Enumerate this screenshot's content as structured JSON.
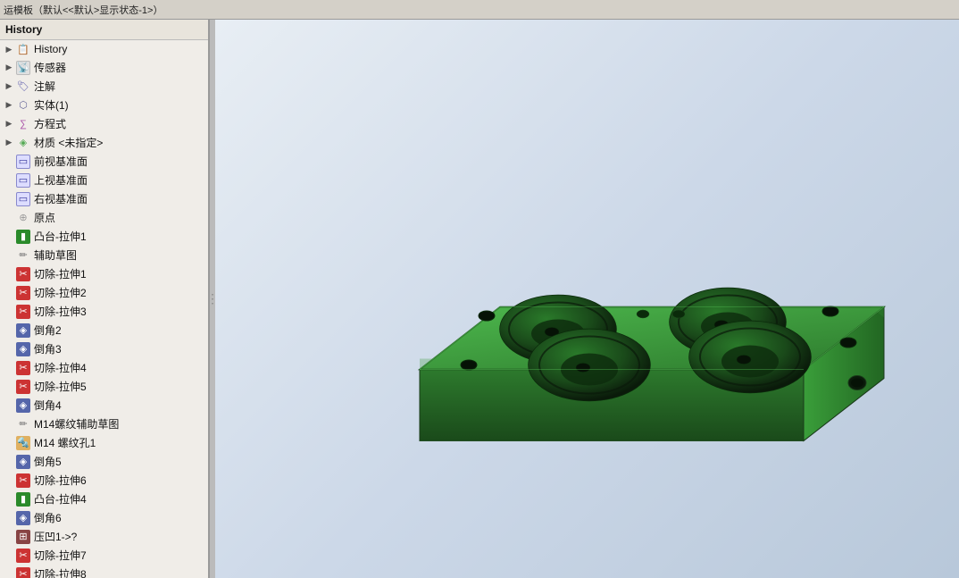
{
  "topbar": {
    "title": "运模板（默认<<默认>显示状态-1>）"
  },
  "tree": {
    "header": "History",
    "items": [
      {
        "id": "history",
        "label": "History",
        "icon": "history",
        "arrow": true,
        "indent": 0
      },
      {
        "id": "sensors",
        "label": "传感器",
        "icon": "sensor",
        "arrow": true,
        "indent": 0
      },
      {
        "id": "notes",
        "label": "注解",
        "icon": "note",
        "arrow": true,
        "indent": 0
      },
      {
        "id": "solid",
        "label": "实体(1)",
        "icon": "solid",
        "arrow": true,
        "indent": 0
      },
      {
        "id": "equation",
        "label": "方程式",
        "icon": "equation",
        "arrow": true,
        "indent": 0
      },
      {
        "id": "material",
        "label": "材质 <未指定>",
        "icon": "material",
        "arrow": true,
        "indent": 0
      },
      {
        "id": "front-plane",
        "label": "前视基准面",
        "icon": "plane",
        "arrow": false,
        "indent": 0
      },
      {
        "id": "top-plane",
        "label": "上视基准面",
        "icon": "plane",
        "arrow": false,
        "indent": 0
      },
      {
        "id": "right-plane",
        "label": "右视基准面",
        "icon": "plane",
        "arrow": false,
        "indent": 0
      },
      {
        "id": "origin",
        "label": "原点",
        "icon": "origin",
        "arrow": false,
        "indent": 0
      },
      {
        "id": "boss-extrude1",
        "label": "凸台-拉伸1",
        "icon": "boss",
        "arrow": false,
        "indent": 0
      },
      {
        "id": "sketch-aux",
        "label": "辅助草图",
        "icon": "sketch",
        "arrow": false,
        "indent": 0
      },
      {
        "id": "cut-extrude1",
        "label": "切除-拉伸1",
        "icon": "cut",
        "arrow": false,
        "indent": 0
      },
      {
        "id": "cut-extrude2",
        "label": "切除-拉伸2",
        "icon": "cut",
        "arrow": false,
        "indent": 0
      },
      {
        "id": "cut-extrude3",
        "label": "切除-拉伸3",
        "icon": "cut",
        "arrow": false,
        "indent": 0
      },
      {
        "id": "fillet2",
        "label": "倒角2",
        "icon": "fillet",
        "arrow": false,
        "indent": 0
      },
      {
        "id": "fillet3",
        "label": "倒角3",
        "icon": "fillet",
        "arrow": false,
        "indent": 0
      },
      {
        "id": "cut-extrude4",
        "label": "切除-拉伸4",
        "icon": "cut",
        "arrow": false,
        "indent": 0
      },
      {
        "id": "cut-extrude5",
        "label": "切除-拉伸5",
        "icon": "cut",
        "arrow": false,
        "indent": 0
      },
      {
        "id": "fillet4",
        "label": "倒角4",
        "icon": "fillet",
        "arrow": false,
        "indent": 0
      },
      {
        "id": "thread-sketch",
        "label": "M14螺纹辅助草图",
        "icon": "sketch",
        "arrow": false,
        "indent": 0
      },
      {
        "id": "thread-hole1",
        "label": "M14 螺纹孔1",
        "icon": "thread",
        "arrow": false,
        "indent": 0
      },
      {
        "id": "fillet5",
        "label": "倒角5",
        "icon": "fillet",
        "arrow": false,
        "indent": 0
      },
      {
        "id": "cut-extrude6",
        "label": "切除-拉伸6",
        "icon": "cut",
        "arrow": false,
        "indent": 0
      },
      {
        "id": "boss-extrude4",
        "label": "凸台-拉伸4",
        "icon": "boss",
        "arrow": false,
        "indent": 0
      },
      {
        "id": "fillet6",
        "label": "倒角6",
        "icon": "fillet",
        "arrow": false,
        "indent": 0
      },
      {
        "id": "emboss1",
        "label": "压凹1->?",
        "icon": "emboss",
        "arrow": false,
        "indent": 0
      },
      {
        "id": "cut-extrude7",
        "label": "切除-拉伸7",
        "icon": "cut",
        "arrow": false,
        "indent": 0
      },
      {
        "id": "cut-extrude8",
        "label": "切除-拉伸8",
        "icon": "cut",
        "arrow": false,
        "indent": 0
      }
    ]
  },
  "icons": {
    "history": "📋",
    "sensor": "📡",
    "note": "📝",
    "solid": "🔷",
    "equation": "∑",
    "material": "🎨",
    "plane": "▭",
    "origin": "✛",
    "boss": "⬛",
    "sketch": "📐",
    "cut": "✂",
    "fillet": "◈",
    "thread": "🔩",
    "emboss": "⊞",
    "expand_arrow": "▶",
    "collapse_arrow": "▼"
  },
  "part": {
    "description": "Green machined block with 4 large circular pockets and smaller holes"
  }
}
